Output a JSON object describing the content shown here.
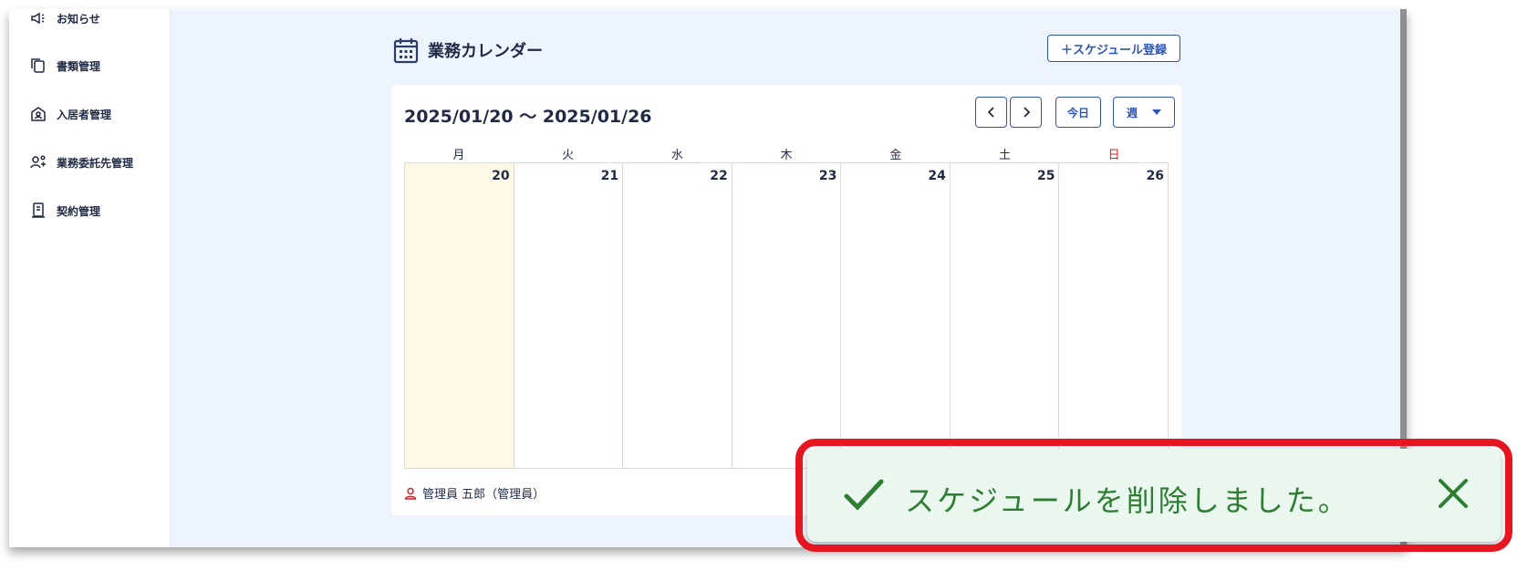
{
  "sidebar": {
    "items": [
      {
        "label": "お知らせ",
        "icon": "megaphone-icon"
      },
      {
        "label": "書類管理",
        "icon": "documents-icon"
      },
      {
        "label": "入居者管理",
        "icon": "resident-icon"
      },
      {
        "label": "業務委託先管理",
        "icon": "contractor-icon"
      },
      {
        "label": "契約管理",
        "icon": "contract-icon"
      }
    ]
  },
  "header": {
    "title": "業務カレンダー",
    "add_button": "＋スケジュール登録"
  },
  "calendar": {
    "range": "2025/01/20 〜 2025/01/26",
    "today_label": "今日",
    "view_label": "週",
    "weekdays": [
      "月",
      "火",
      "水",
      "木",
      "金",
      "土",
      "日"
    ],
    "days": [
      "20",
      "21",
      "22",
      "23",
      "24",
      "25",
      "26"
    ],
    "today_index": 0,
    "user": "管理員 五郎（管理員）"
  },
  "toast": {
    "message": "スケジュールを削除しました。"
  },
  "colors": {
    "accent": "#2b55b8",
    "sunday": "#d11f2a",
    "today_bg": "#fef9e4",
    "toast_bg": "#e9f7ef",
    "toast_text": "#2e7d32",
    "highlight": "#e5161f"
  }
}
